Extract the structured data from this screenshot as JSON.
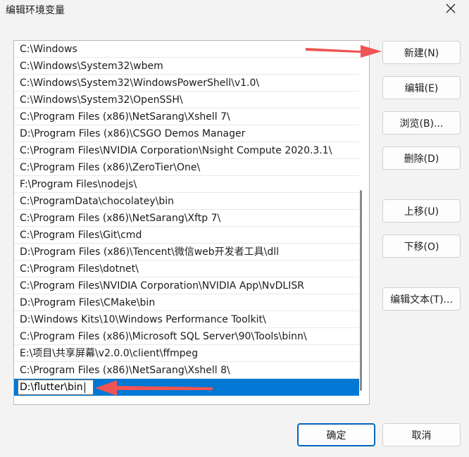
{
  "window": {
    "title": "编辑环境变量",
    "close_icon": "close-icon"
  },
  "paths": [
    "C:\\Windows",
    "C:\\Windows\\System32\\wbem",
    "C:\\Windows\\System32\\WindowsPowerShell\\v1.0\\",
    "C:\\Windows\\System32\\OpenSSH\\",
    "C:\\Program Files (x86)\\NetSarang\\Xshell 7\\",
    "D:\\Program Files (x86)\\CSGO Demos Manager",
    "C:\\Program Files\\NVIDIA Corporation\\Nsight Compute 2020.3.1\\",
    "C:\\Program Files (x86)\\ZeroTier\\One\\",
    "F:\\Program Files\\nodejs\\",
    "C:\\ProgramData\\chocolatey\\bin",
    "C:\\Program Files (x86)\\NetSarang\\Xftp 7\\",
    "C:\\Program Files\\Git\\cmd",
    "D:\\Program Files (x86)\\Tencent\\微信web开发者工具\\dll",
    "C:\\Program Files\\dotnet\\",
    "C:\\Program Files\\NVIDIA Corporation\\NVIDIA App\\NvDLISR",
    "D:\\Program Files\\CMake\\bin",
    "D:\\Windows Kits\\10\\Windows Performance Toolkit\\",
    "C:\\Program Files (x86)\\Microsoft SQL Server\\90\\Tools\\binn\\",
    "E:\\项目\\共享屏幕\\v2.0.0\\client\\ffmpeg",
    "C:\\Program Files (x86)\\NetSarang\\Xshell 8\\"
  ],
  "editing_row": {
    "value": "D:\\flutter\\bin"
  },
  "buttons": {
    "new": "新建(N)",
    "edit": "编辑(E)",
    "browse": "浏览(B)...",
    "delete": "删除(D)",
    "move_up": "上移(U)",
    "move_down": "下移(O)",
    "edit_text": "编辑文本(T)...",
    "ok": "确定",
    "cancel": "取消"
  },
  "colors": {
    "selection": "#0078d4",
    "annotation_arrow": "#f05454"
  }
}
